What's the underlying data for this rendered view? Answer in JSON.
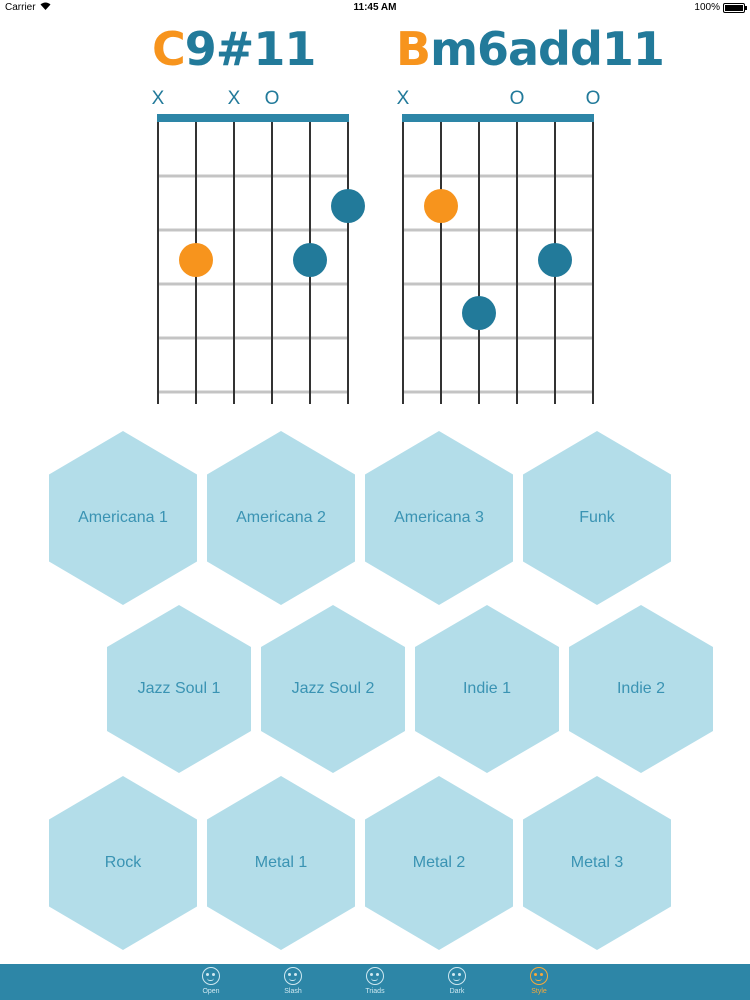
{
  "status_bar": {
    "carrier": "Carrier",
    "time": "11:45 AM",
    "battery": "100%"
  },
  "chords": [
    {
      "root": "C",
      "suffix": "9#11",
      "markers": [
        {
          "string": 0,
          "symbol": "X"
        },
        {
          "string": 2,
          "symbol": "X"
        },
        {
          "string": 3,
          "symbol": "O"
        }
      ],
      "dots": [
        {
          "string": 1,
          "fret": 3,
          "color": "orange"
        },
        {
          "string": 4,
          "fret": 3,
          "color": "blue"
        },
        {
          "string": 5,
          "fret": 2,
          "color": "blue"
        }
      ]
    },
    {
      "root": "B",
      "suffix": "m6add11",
      "markers": [
        {
          "string": 0,
          "symbol": "X"
        },
        {
          "string": 3,
          "symbol": "O"
        },
        {
          "string": 5,
          "symbol": "O"
        }
      ],
      "dots": [
        {
          "string": 1,
          "fret": 2,
          "color": "orange"
        },
        {
          "string": 2,
          "fret": 4,
          "color": "blue"
        },
        {
          "string": 4,
          "fret": 3,
          "color": "blue"
        }
      ]
    }
  ],
  "colors": {
    "accent_blue": "#227a9a",
    "accent_orange": "#f7941d",
    "hex_fill": "#b3dde9",
    "tab_bar": "#2d86a7"
  },
  "styles": {
    "row1": [
      "Americana 1",
      "Americana 2",
      "Americana 3",
      "Funk"
    ],
    "row2": [
      "Jazz Soul 1",
      "Jazz Soul 2",
      "Indie 1",
      "Indie 2"
    ],
    "row3": [
      "Rock",
      "Metal 1",
      "Metal 2",
      "Metal 3"
    ]
  },
  "tabs": [
    {
      "label": "Open",
      "icon": "face-icon"
    },
    {
      "label": "Slash",
      "icon": "face-icon"
    },
    {
      "label": "Triads",
      "icon": "face-icon"
    },
    {
      "label": "Dark",
      "icon": "face-icon"
    },
    {
      "label": "Style",
      "icon": "face-icon",
      "active": true
    }
  ]
}
